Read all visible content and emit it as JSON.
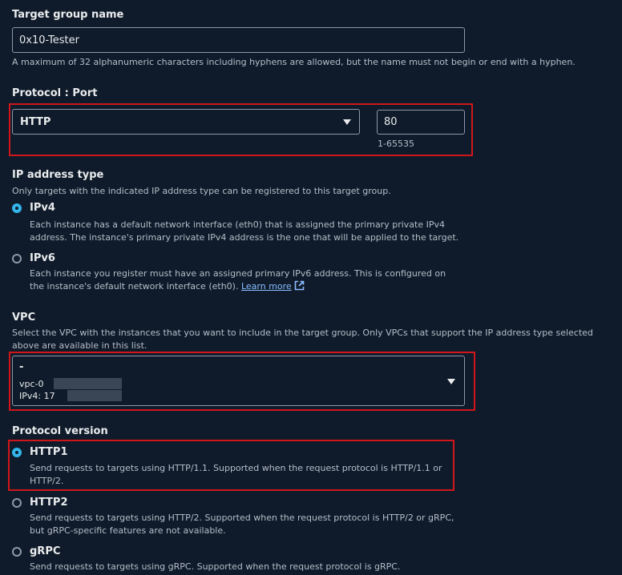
{
  "target_group": {
    "label": "Target group name",
    "value": "0x10-Tester",
    "help": "A maximum of 32 alphanumeric characters including hyphens are allowed, but the name must not begin or end with a hyphen."
  },
  "protocol_port": {
    "label": "Protocol : Port",
    "protocol_value": "HTTP",
    "port_value": "80",
    "port_hint": "1-65535"
  },
  "ip_address_type": {
    "label": "IP address type",
    "help": "Only targets with the indicated IP address type can be registered to this target group.",
    "options": [
      {
        "title": "IPv4",
        "desc": "Each instance has a default network interface (eth0) that is assigned the primary private IPv4 address. The instance's primary private IPv4 address is the one that will be applied to the target.",
        "checked": true
      },
      {
        "title": "IPv6",
        "desc": "Each instance you register must have an assigned primary IPv6 address. This is configured on the instance's default network interface (eth0).",
        "link": "Learn more",
        "checked": false
      }
    ]
  },
  "vpc": {
    "label": "VPC",
    "help": "Select the VPC with the instances that you want to include in the target group. Only VPCs that support the IP address type selected above are available in this list.",
    "selected_name": "-",
    "vpc_id_prefix": "vpc-0",
    "ipv4_prefix": "IPv4: 17"
  },
  "protocol_version": {
    "label": "Protocol version",
    "options": [
      {
        "title": "HTTP1",
        "desc": "Send requests to targets using HTTP/1.1. Supported when the request protocol is HTTP/1.1 or HTTP/2.",
        "checked": true
      },
      {
        "title": "HTTP2",
        "desc": "Send requests to targets using HTTP/2. Supported when the request protocol is HTTP/2 or gRPC, but gRPC-specific features are not available.",
        "checked": false
      },
      {
        "title": "gRPC",
        "desc": "Send requests to targets using gRPC. Supported when the request protocol is gRPC.",
        "checked": false
      }
    ]
  },
  "colors": {
    "accent": "#33b5ea",
    "highlight": "#d0161b",
    "background": "#0f1b2a"
  }
}
